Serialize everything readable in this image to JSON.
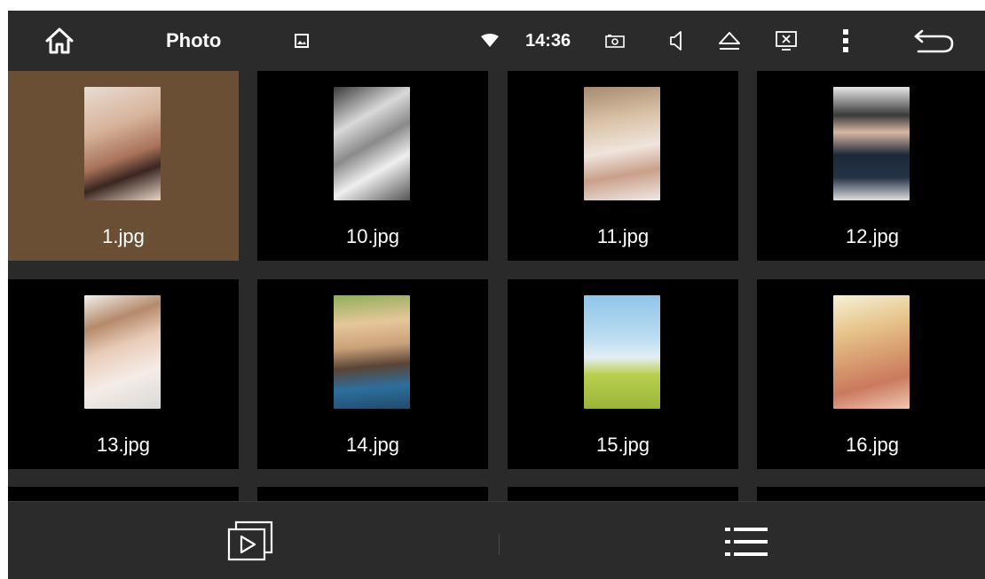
{
  "statusbar": {
    "title": "Photo",
    "time": "14:36"
  },
  "photos": [
    {
      "name": "1.jpg",
      "selected": true
    },
    {
      "name": "10.jpg"
    },
    {
      "name": "11.jpg"
    },
    {
      "name": "12.jpg"
    },
    {
      "name": "13.jpg"
    },
    {
      "name": "14.jpg"
    },
    {
      "name": "15.jpg"
    },
    {
      "name": "16.jpg"
    }
  ],
  "colors": {
    "bar_bg": "#2b2b2b",
    "tile_bg": "#000000",
    "selected_tile_bg": "#6a4f35",
    "text": "#ffffff"
  },
  "icons": {
    "home": "home-icon",
    "gallery": "gallery-icon",
    "wifi": "wifi-icon",
    "camera": "camera-icon",
    "volume": "volume-icon",
    "eject": "eject-icon",
    "close_screen": "close-screen-icon",
    "more": "more-vert-icon",
    "back": "back-icon",
    "slideshow": "slideshow-icon",
    "list": "list-icon"
  }
}
